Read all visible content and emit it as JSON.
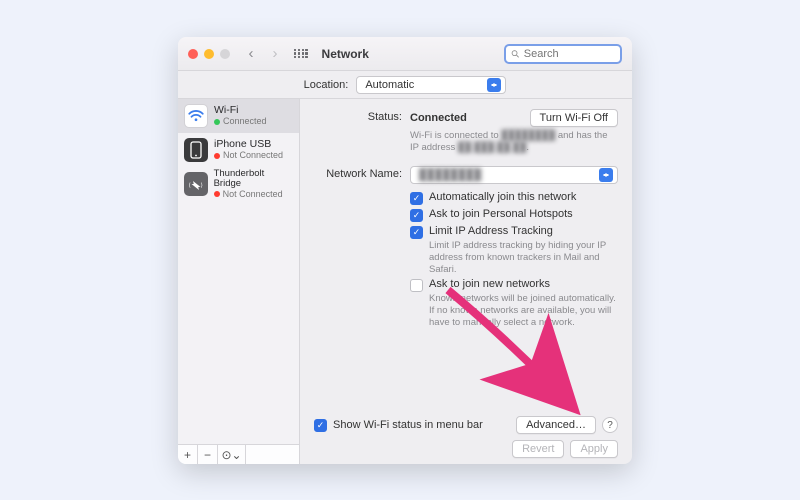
{
  "window": {
    "title": "Network"
  },
  "search": {
    "placeholder": "Search"
  },
  "location": {
    "label": "Location:",
    "value": "Automatic"
  },
  "sidebar": {
    "items": [
      {
        "name": "Wi-Fi",
        "status": "Connected",
        "selected": true,
        "icon": "wifi",
        "dot": "green"
      },
      {
        "name": "iPhone USB",
        "status": "Not Connected",
        "selected": false,
        "icon": "iphone",
        "dot": "red"
      },
      {
        "name": "Thunderbolt Bridge",
        "status": "Not Connected",
        "selected": false,
        "icon": "thunderbolt",
        "dot": "red"
      }
    ],
    "footer": {
      "add": "+",
      "remove": "−",
      "gear": "⊙⌄"
    }
  },
  "main": {
    "status_label": "Status:",
    "status_value": "Connected",
    "wifi_off_btn": "Turn Wi-Fi Off",
    "status_hint_a": "Wi-Fi is connected to ",
    "status_hint_ssid": "████████",
    "status_hint_b": " and has the IP address ",
    "status_hint_ip": "██.███.██.██",
    "network_name_label": "Network Name:",
    "network_name_value": "████████",
    "cbx_autojoin": "Automatically join this network",
    "cbx_hotspots": "Ask to join Personal Hotspots",
    "cbx_limitip": "Limit IP Address Tracking",
    "limitip_hint": "Limit IP address tracking by hiding your IP address from known trackers in Mail and Safari.",
    "cbx_newnet": "Ask to join new networks",
    "newnet_hint": "Known networks will be joined automatically. If no known networks are available, you will have to manually select a network."
  },
  "footer": {
    "show_menubar": "Show Wi-Fi status in menu bar",
    "advanced": "Advanced…",
    "help": "?",
    "revert": "Revert",
    "apply": "Apply"
  }
}
